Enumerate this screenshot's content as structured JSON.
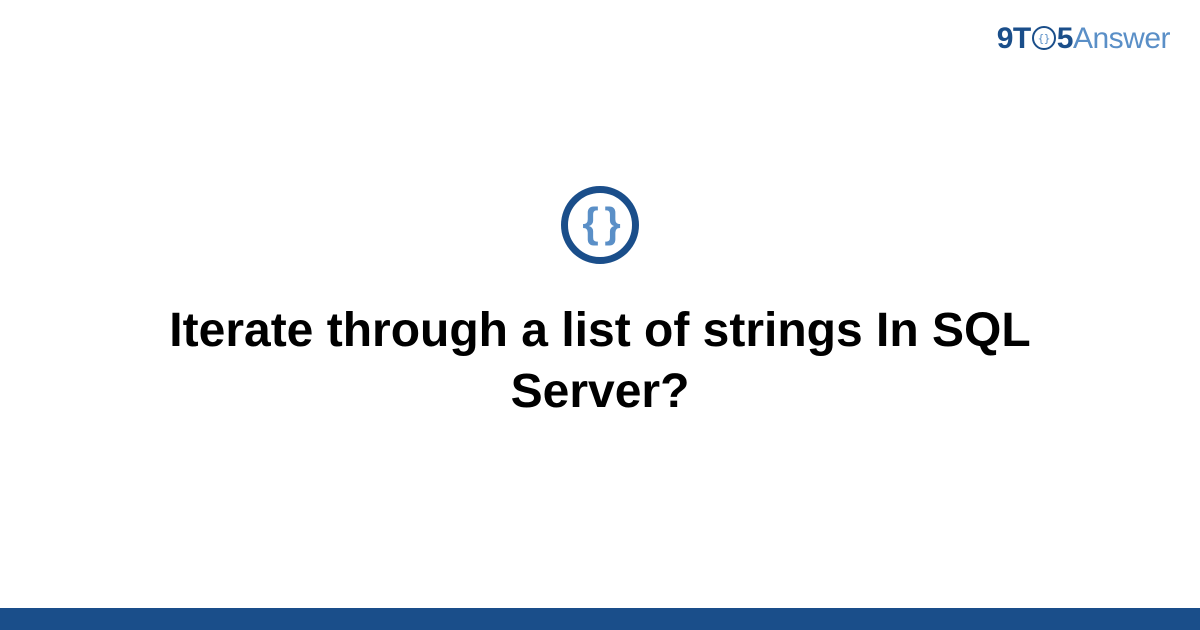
{
  "logo": {
    "part1": "9T",
    "clock_inner": "{}",
    "part2": "5",
    "part3": "Answer"
  },
  "icon": {
    "glyph": "{ }",
    "name": "code-braces-icon"
  },
  "title": "Iterate through a list of strings In SQL Server?",
  "colors": {
    "primary": "#1a4e8a",
    "secondary": "#5a8fc7",
    "background": "#ffffff"
  }
}
